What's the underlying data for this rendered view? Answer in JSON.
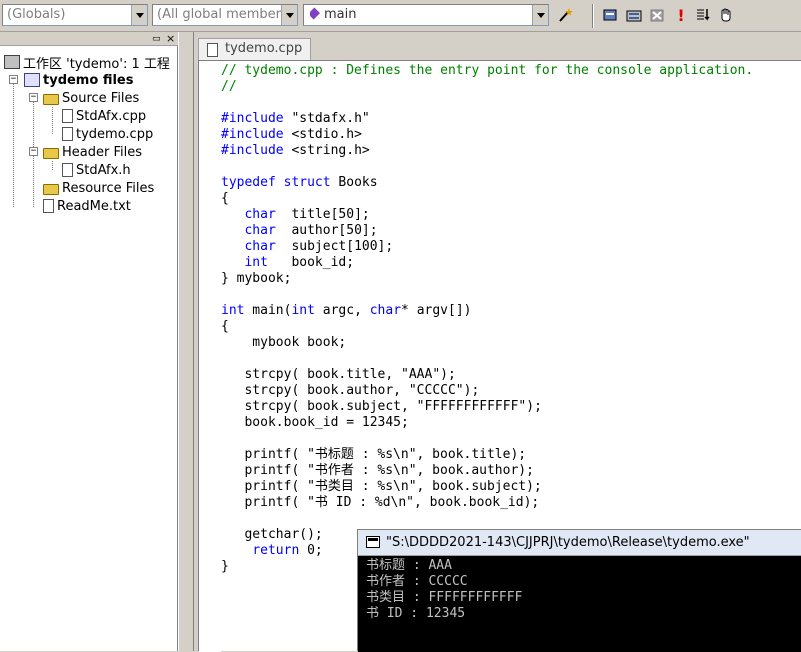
{
  "toolbar": {
    "scope_combo": "(Globals)",
    "members_combo": "(All global members",
    "function_combo": "main",
    "buttons": [
      "wizard-wand",
      "class-view",
      "go",
      "stop",
      "build",
      "list",
      "hand"
    ]
  },
  "workspace": {
    "root_label": "工作区 'tydemo': 1 工程",
    "project_label": "tydemo files",
    "source_folder": "Source Files",
    "source_files": [
      "StdAfx.cpp",
      "tydemo.cpp"
    ],
    "header_folder": "Header Files",
    "header_files": [
      "StdAfx.h"
    ],
    "resource_folder": "Resource Files",
    "readme": "ReadMe.txt"
  },
  "editor": {
    "tab_label": "tydemo.cpp",
    "lines": [
      [
        {
          "t": "// tydemo.cpp : Defines the entry point for the console application.",
          "c": "cm"
        }
      ],
      [
        {
          "t": "//",
          "c": "cm"
        }
      ],
      [],
      [
        {
          "t": "#include",
          "c": "kw"
        },
        {
          "t": " \"stdafx.h\""
        }
      ],
      [
        {
          "t": "#include",
          "c": "kw"
        },
        {
          "t": " <stdio.h>"
        }
      ],
      [
        {
          "t": "#include",
          "c": "kw"
        },
        {
          "t": " <string.h>"
        }
      ],
      [],
      [
        {
          "t": "typedef",
          "c": "kw"
        },
        {
          "t": " "
        },
        {
          "t": "struct",
          "c": "kw"
        },
        {
          "t": " Books"
        }
      ],
      [
        {
          "t": "{"
        }
      ],
      [
        {
          "t": "   "
        },
        {
          "t": "char",
          "c": "kw"
        },
        {
          "t": "  title[50];"
        }
      ],
      [
        {
          "t": "   "
        },
        {
          "t": "char",
          "c": "kw"
        },
        {
          "t": "  author[50];"
        }
      ],
      [
        {
          "t": "   "
        },
        {
          "t": "char",
          "c": "kw"
        },
        {
          "t": "  subject[100];"
        }
      ],
      [
        {
          "t": "   "
        },
        {
          "t": "int",
          "c": "kw"
        },
        {
          "t": "   book_id;"
        }
      ],
      [
        {
          "t": "} mybook;"
        }
      ],
      [],
      [
        {
          "t": "int",
          "c": "kw"
        },
        {
          "t": " main("
        },
        {
          "t": "int",
          "c": "kw"
        },
        {
          "t": " argc, "
        },
        {
          "t": "char",
          "c": "kw"
        },
        {
          "t": "* argv[])"
        }
      ],
      [
        {
          "t": "{"
        }
      ],
      [
        {
          "t": "    mybook book;"
        }
      ],
      [],
      [
        {
          "t": "   strcpy( book.title, \"AAA\");"
        }
      ],
      [
        {
          "t": "   strcpy( book.author, \"CCCCC\");"
        }
      ],
      [
        {
          "t": "   strcpy( book.subject, \"FFFFFFFFFFFF\");"
        }
      ],
      [
        {
          "t": "   book.book_id = 12345;"
        }
      ],
      [],
      [
        {
          "t": "   printf( \"书标题 : %s\\n\", book.title);"
        }
      ],
      [
        {
          "t": "   printf( \"书作者 : %s\\n\", book.author);"
        }
      ],
      [
        {
          "t": "   printf( \"书类目 : %s\\n\", book.subject);"
        }
      ],
      [
        {
          "t": "   printf( \"书 ID : %d\\n\", book.book_id);"
        }
      ],
      [],
      [
        {
          "t": "   getchar();"
        }
      ],
      [
        {
          "t": "    "
        },
        {
          "t": "return",
          "c": "kw"
        },
        {
          "t": " 0;"
        }
      ],
      [
        {
          "t": "}"
        }
      ]
    ]
  },
  "console": {
    "title": "\"S:\\DDDD2021-143\\CJJPRJ\\tydemo\\Release\\tydemo.exe\"",
    "output": [
      "书标题 : AAA",
      "书作者 : CCCCC",
      "书类目 : FFFFFFFFFFFF",
      "书 ID : 12345"
    ]
  }
}
